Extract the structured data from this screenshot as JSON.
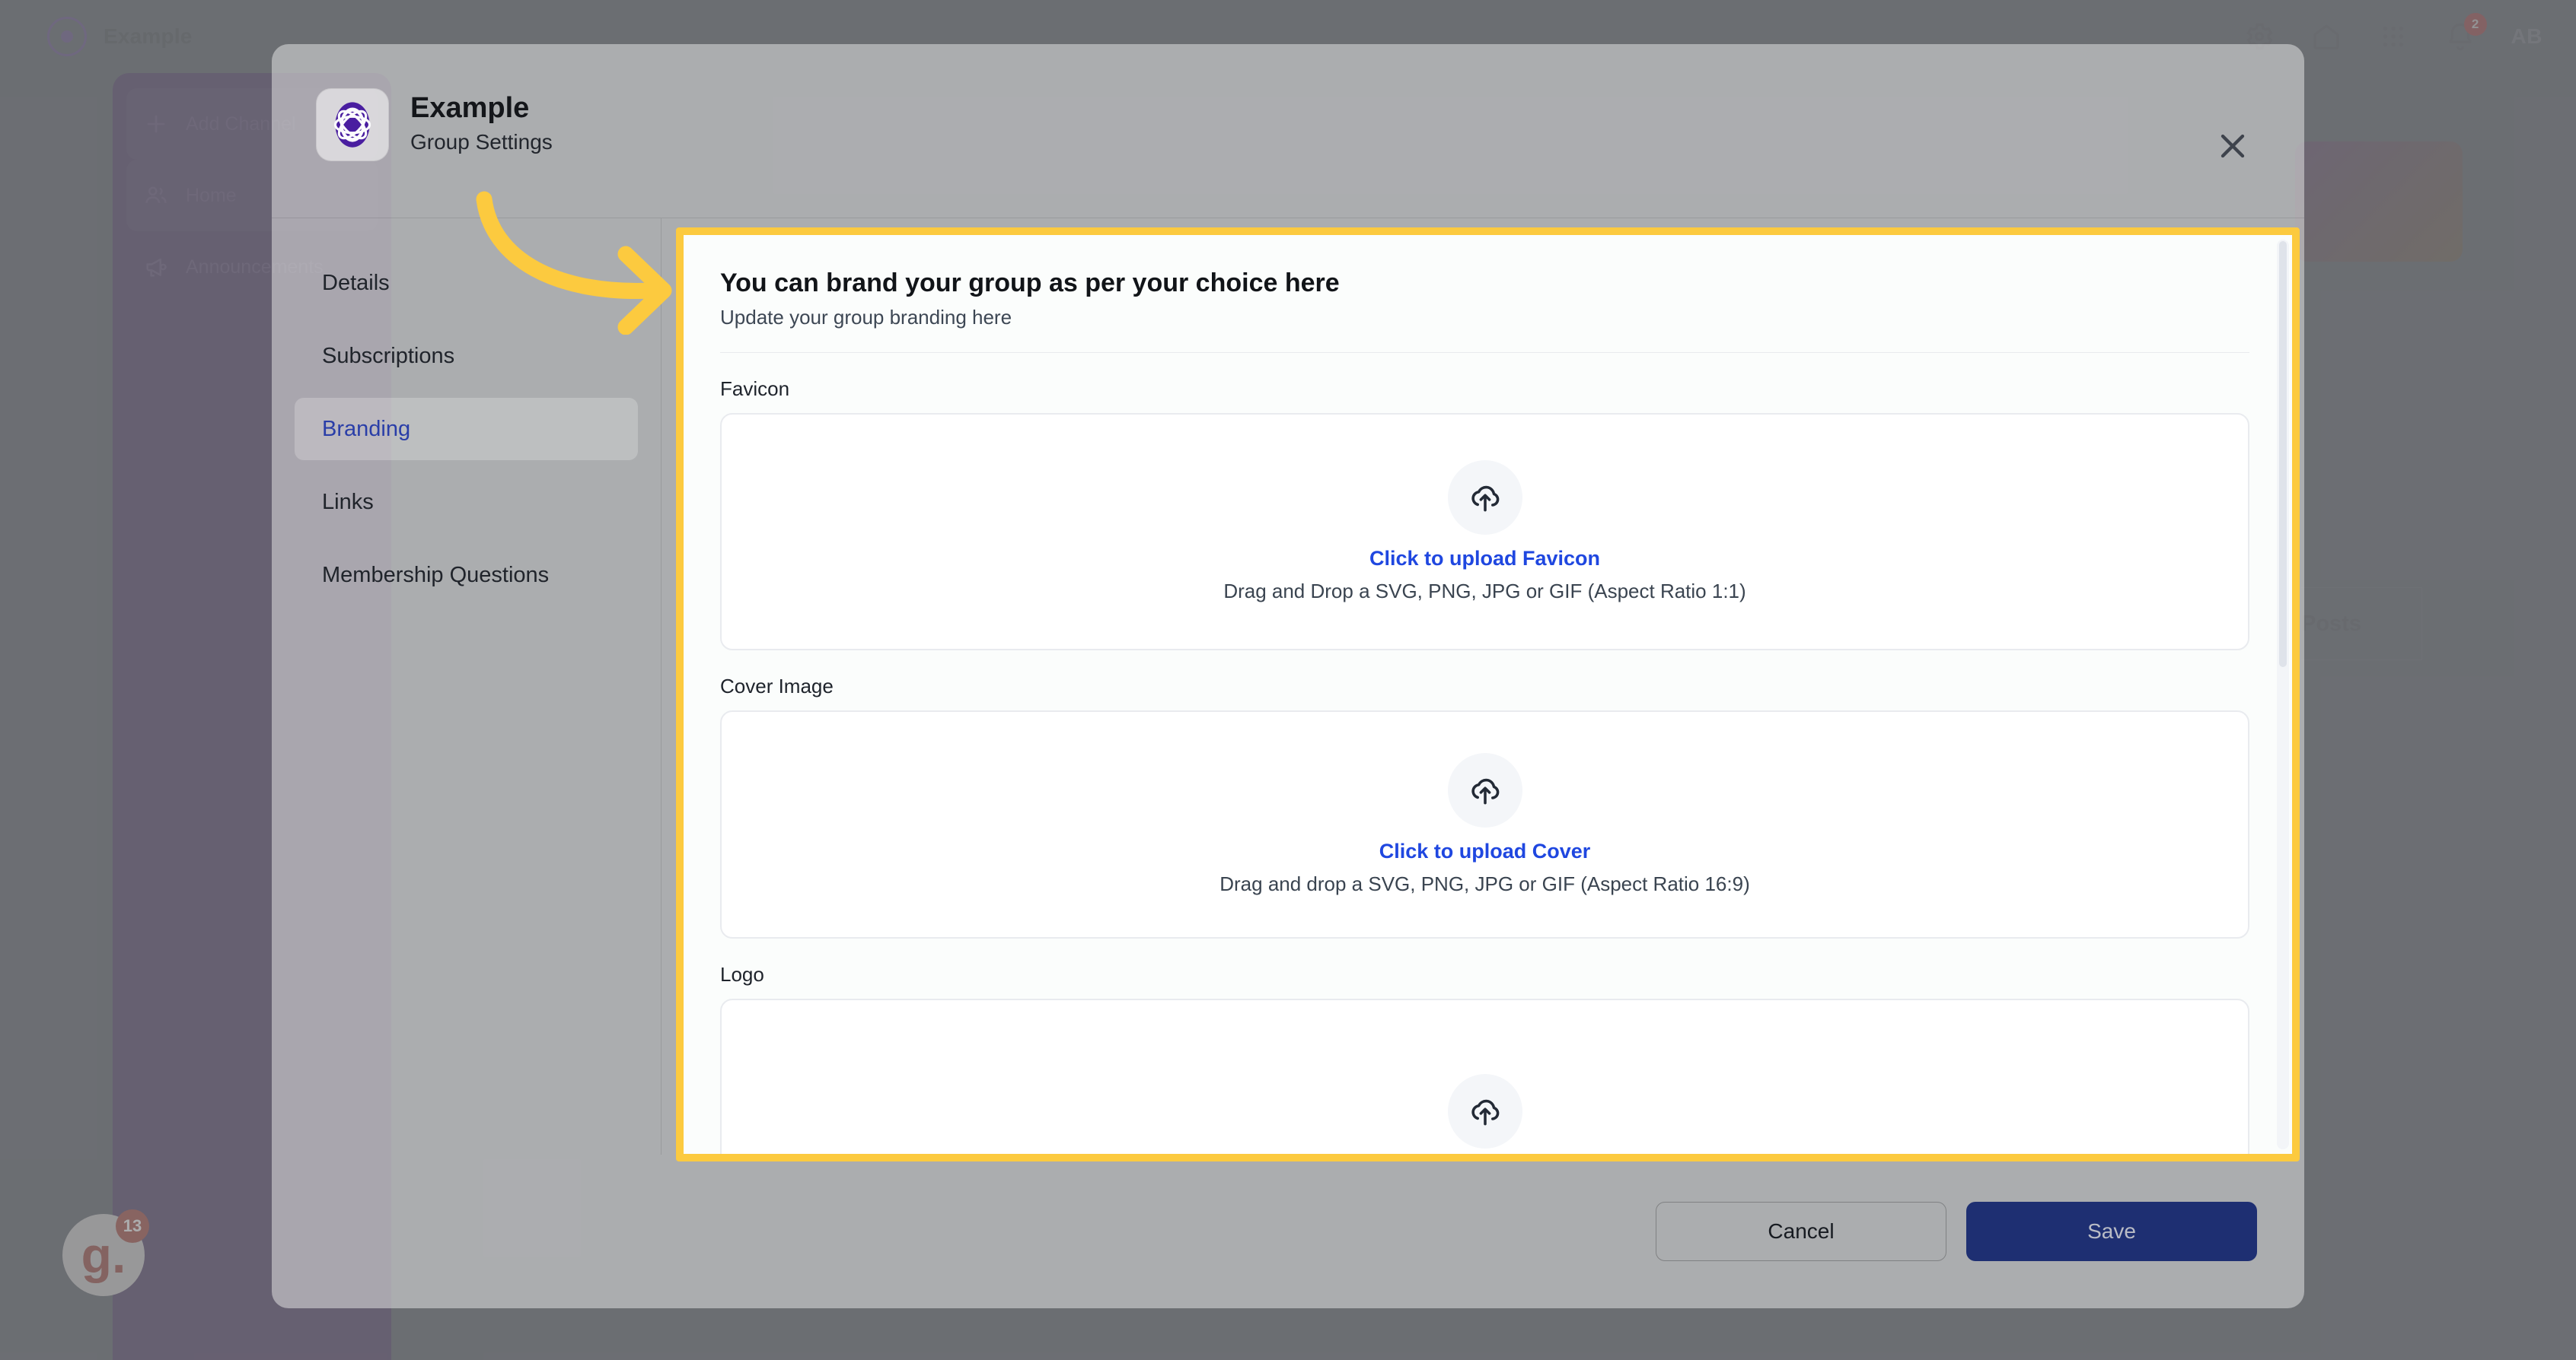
{
  "background": {
    "brand_name": "Example",
    "topbar_icons": [
      {
        "name": "settings-icon"
      },
      {
        "name": "home-icon"
      },
      {
        "name": "apps-grid-icon"
      },
      {
        "name": "notifications-bell-icon"
      }
    ],
    "notification_count": "2",
    "avatar_initials": "AB",
    "rail_items": [
      {
        "label": "Add Channel",
        "icon": "plus-icon"
      },
      {
        "label": "Home",
        "icon": "people-icon"
      },
      {
        "label": "Announcements",
        "icon": "megaphone-icon"
      }
    ],
    "posts_tab_label": "Posts",
    "helper_widget": {
      "letter": "g.",
      "badge": "13"
    }
  },
  "modal": {
    "logo_icon": "example-group-logo",
    "title": "Example",
    "subtitle": "Group Settings",
    "close_icon": "close-icon",
    "nav": {
      "items": [
        {
          "label": "Details",
          "active": false
        },
        {
          "label": "Subscriptions",
          "active": false
        },
        {
          "label": "Branding",
          "active": true
        },
        {
          "label": "Links",
          "active": false
        },
        {
          "label": "Membership Questions",
          "active": false
        }
      ]
    },
    "panel": {
      "heading": "You can brand your group as per your choice here",
      "subheading": "Update your group branding here",
      "fields": [
        {
          "label": "Favicon",
          "cta": "Click to upload Favicon",
          "hint": "Drag and Drop a SVG, PNG, JPG or GIF (Aspect Ratio 1:1)",
          "icon": "cloud-upload-icon"
        },
        {
          "label": "Cover Image",
          "cta": "Click to upload Cover",
          "hint": "Drag and drop a SVG, PNG, JPG or GIF (Aspect Ratio 16:9)",
          "icon": "cloud-upload-icon"
        },
        {
          "label": "Logo",
          "cta": "",
          "hint": "",
          "icon": "cloud-upload-icon"
        }
      ]
    },
    "footer": {
      "cancel_label": "Cancel",
      "save_label": "Save"
    }
  },
  "annotation": {
    "arrow_icon": "curved-arrow-right",
    "arrow_color": "#fcca3f",
    "highlight_color": "#fcca3f"
  },
  "colors": {
    "accent_link": "#1f47e0",
    "nav_active_text": "#2a3ea8",
    "save_button": "#1e2f72",
    "highlight": "#fcca3f",
    "rail_purple": "#2a1c42",
    "app_background": "#363b46"
  }
}
